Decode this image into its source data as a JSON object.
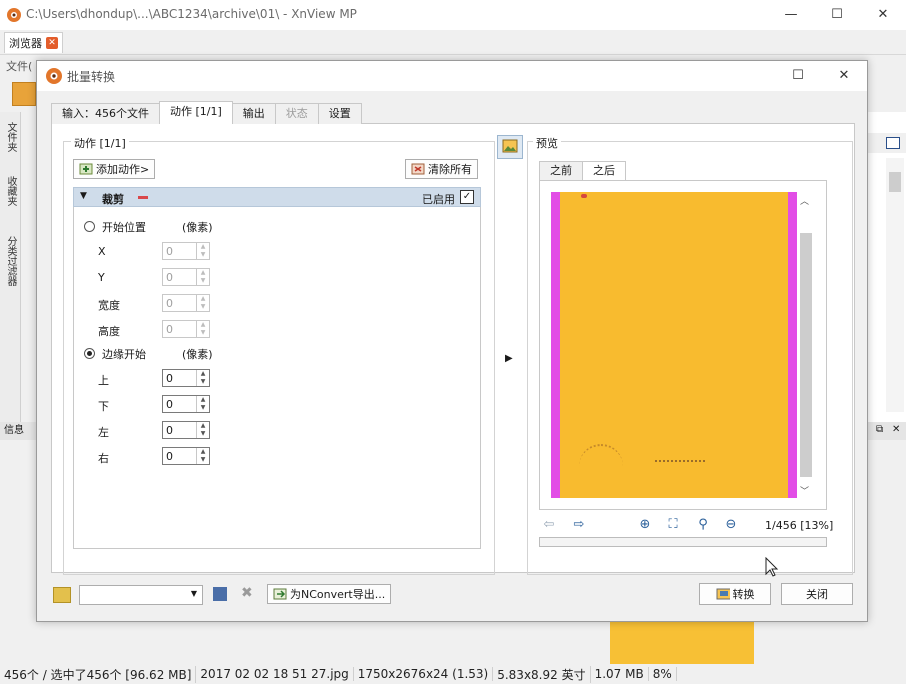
{
  "main_window": {
    "title": "C:\\Users\\dhondup\\...\\ABC1234\\archive\\01\\ - XnView MP",
    "tab_label": "浏览器",
    "menu_file": "文件(",
    "left_tabs": [
      "文件夹",
      "收藏夹",
      "分类过滤器"
    ],
    "info_label": "信息",
    "status": {
      "selection": "456个 / 选中了456个 [96.62 MB]",
      "filename": "2017 02 02 18 51 27.jpg",
      "dimensions": "1750x2676x24 (1.53)",
      "print_size": "5.83x8.92 英寸",
      "file_size": "1.07 MB",
      "zoom": "8%"
    }
  },
  "dialog": {
    "title": "批量转换",
    "tabs": [
      {
        "label": "输入：456个文件",
        "state": "normal"
      },
      {
        "label": "动作 [1/1]",
        "state": "active"
      },
      {
        "label": "输出",
        "state": "normal"
      },
      {
        "label": "状态",
        "state": "disabled"
      },
      {
        "label": "设置",
        "state": "normal"
      }
    ],
    "actions": {
      "group_title": "动作 [1/1]",
      "add_action": "添加动作>",
      "clear_all": "清除所有",
      "crop": {
        "name": "裁剪",
        "enabled_label": "已启用",
        "enabled": true,
        "start_position": {
          "label": "开始位置",
          "unit": "(像素)",
          "selected": false,
          "fields": [
            {
              "label": "X",
              "value": "0"
            },
            {
              "label": "Y",
              "value": "0"
            },
            {
              "label": "宽度",
              "value": "0"
            },
            {
              "label": "高度",
              "value": "0"
            }
          ]
        },
        "from_edges": {
          "label": "边缘开始",
          "unit": "(像素)",
          "selected": true,
          "fields": [
            {
              "label": "上",
              "value": "0"
            },
            {
              "label": "下",
              "value": "0"
            },
            {
              "label": "左",
              "value": "0"
            },
            {
              "label": "右",
              "value": "0"
            }
          ]
        }
      }
    },
    "preview": {
      "group_title": "预览",
      "tabs": [
        {
          "label": "之前",
          "active": false
        },
        {
          "label": "之后",
          "active": true
        }
      ],
      "page_info": "1/456 [13%]",
      "tools": [
        "prev-icon",
        "next-icon",
        "zoom-in-icon",
        "fit-icon",
        "zoom-icon",
        "zoom-out-icon"
      ]
    },
    "footer": {
      "preset_value": "",
      "export_nconvert": "为NConvert导出...",
      "convert": "转换",
      "close": "关闭"
    }
  },
  "colors": {
    "page_yellow": "#f8bb2f",
    "page_margin_magenta": "#e24de6",
    "header_blue": "#cfdcea"
  }
}
